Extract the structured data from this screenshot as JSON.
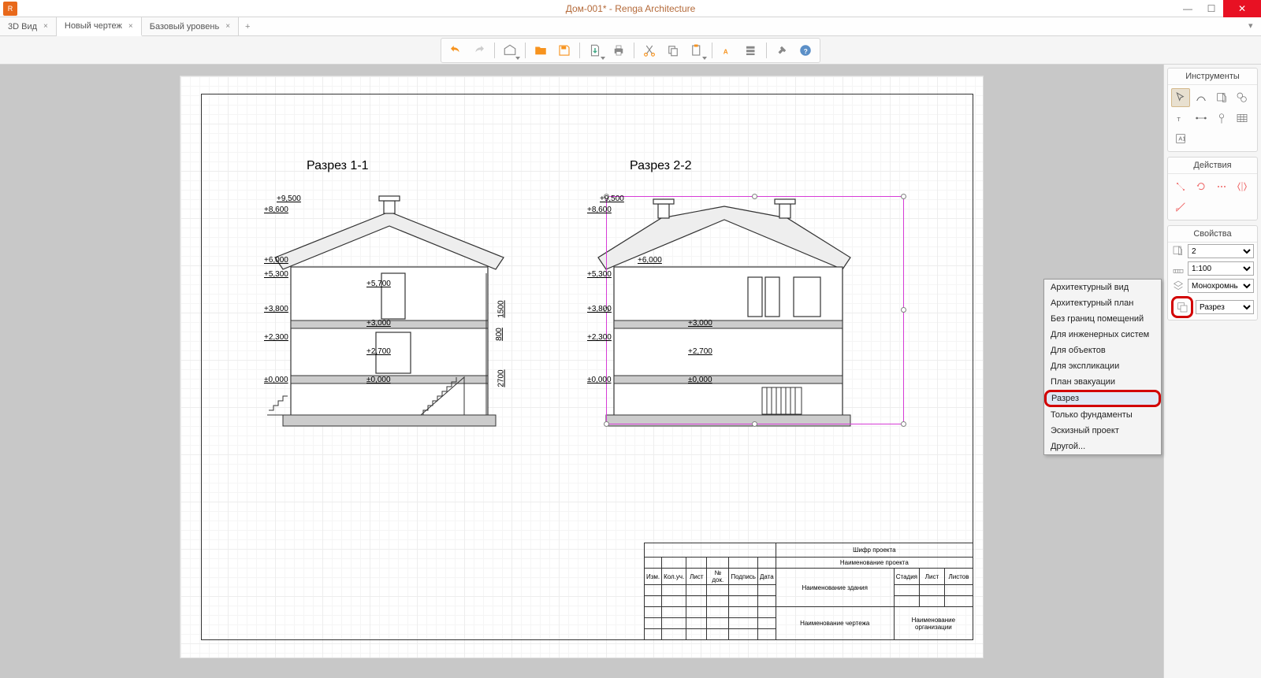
{
  "title": "Дом-001* - Renga Architecture",
  "tabs": [
    {
      "label": "3D Вид",
      "active": false
    },
    {
      "label": "Новый чертеж",
      "active": true
    },
    {
      "label": "Базовый уровень",
      "active": false
    }
  ],
  "panels": {
    "tools": "Инструменты",
    "actions": "Действия",
    "properties": "Свойства"
  },
  "properties": {
    "name": "2",
    "scale": "1:100",
    "style": "Монохромнь",
    "view_type": "Разрез"
  },
  "dropdown_items": [
    "Архитектурный вид",
    "Архитектурный план",
    "Без границ помещений",
    "Для инженерных систем",
    "Для объектов",
    "Для экспликации",
    "План эвакуации",
    "Разрез",
    "Только фундаменты",
    "Эскизный проект",
    "Другой..."
  ],
  "dropdown_selected": "Разрез",
  "sections": {
    "s1": {
      "title": "Разрез 1-1"
    },
    "s2": {
      "title": "Разрез 2-2"
    }
  },
  "elevations": [
    "+9,500",
    "+8,600",
    "+6,000",
    "+5,300",
    "+5,700",
    "+3,800",
    "+3,000",
    "+2,300",
    "+2,700",
    "±0,000"
  ],
  "dim_vert": [
    "1500",
    "800",
    "2700"
  ],
  "titleblock": {
    "hdr_cols": [
      "Изм.",
      "Кол.уч.",
      "Лист",
      "№ док.",
      "Подпись",
      "Дата"
    ],
    "r1": "Шифр проекта",
    "r2": "Наименование проекта",
    "r3": "Наименование здания",
    "r3_cols": [
      "Стадия",
      "Лист",
      "Листов"
    ],
    "r4": "Наименование чертежа",
    "r4b": "Наименование организации"
  }
}
